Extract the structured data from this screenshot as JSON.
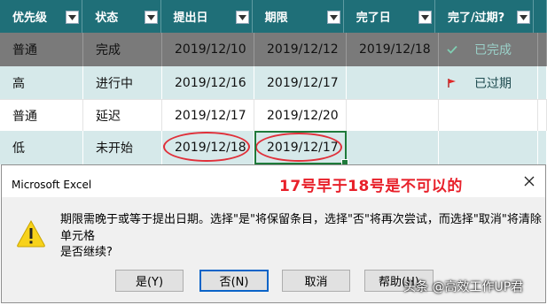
{
  "table": {
    "headers": [
      "优先级",
      "状态",
      "提出日",
      "期限",
      "完了日",
      "完了/过期?"
    ],
    "rows": [
      {
        "priority": "普通",
        "status": "完成",
        "proposed": "2019/12/10",
        "deadline": "2019/12/12",
        "completed": "2019/12/18",
        "flag_icon": "check-icon",
        "flag_text": "已完成"
      },
      {
        "priority": "高",
        "status": "进行中",
        "proposed": "2019/12/16",
        "deadline": "2019/12/17",
        "completed": "",
        "flag_icon": "red-flag-icon",
        "flag_text": "已过期"
      },
      {
        "priority": "普通",
        "status": "延迟",
        "proposed": "2019/12/17",
        "deadline": "2019/12/20",
        "completed": "",
        "flag_icon": "",
        "flag_text": ""
      },
      {
        "priority": "低",
        "status": "未开始",
        "proposed": "2019/12/18",
        "deadline": "2019/12/17",
        "completed": "",
        "flag_icon": "",
        "flag_text": ""
      }
    ]
  },
  "dialog": {
    "title": "Microsoft Excel",
    "annotation": "17号早于18号是不可以的",
    "message_line1": "期限需晚于或等于提出日期。选择\"是\"将保留条目，选择\"否\"将再次尝试，而选择\"取消\"将清除单元格",
    "message_line2": "是否继续?",
    "buttons": {
      "yes": "是(Y)",
      "no": "否(N)",
      "cancel": "取消",
      "help": "帮助(H)"
    }
  },
  "watermark": "头条 @高效工作UP君",
  "colors": {
    "header": "#1f6f78",
    "band": "#d6e9ea",
    "annotation": "#e8202a",
    "selection": "#1e7a3a"
  }
}
